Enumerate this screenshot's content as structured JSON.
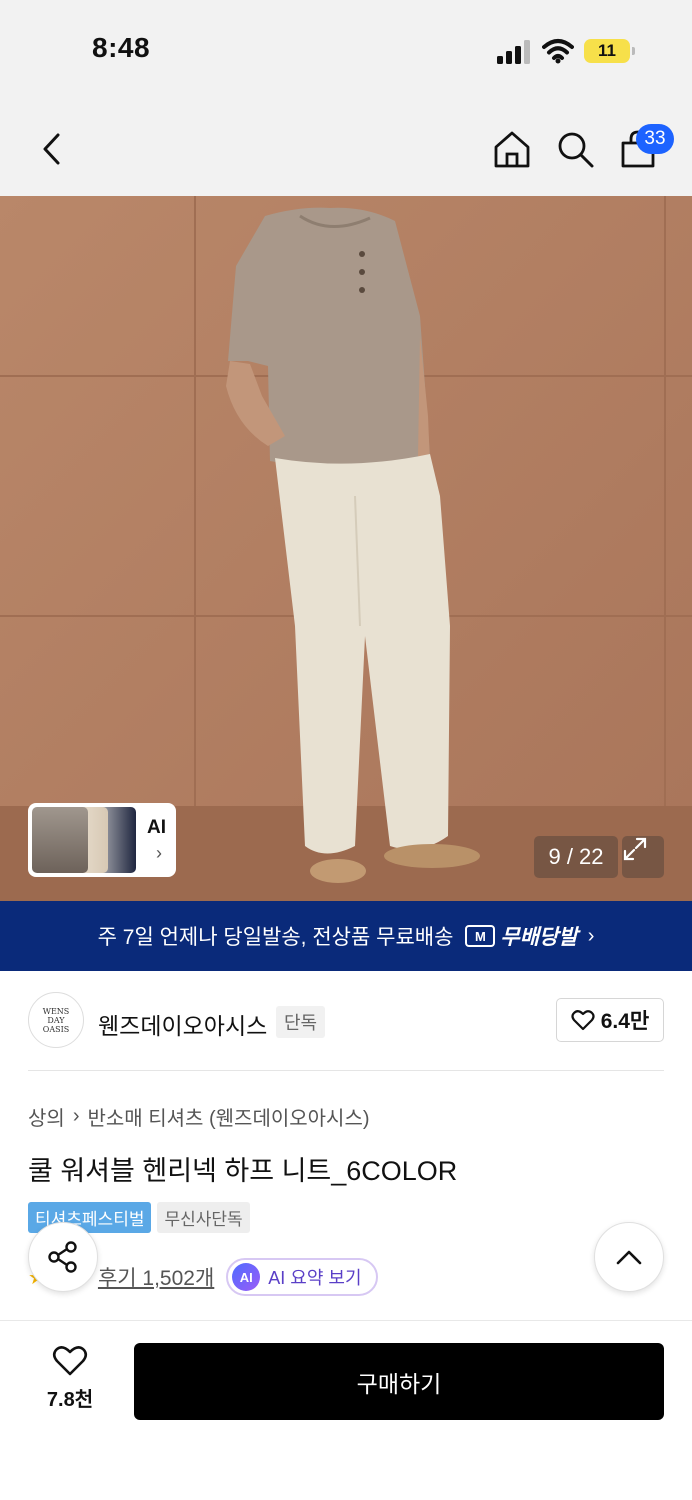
{
  "status_bar": {
    "time": "8:48",
    "battery": "11",
    "battery_level_percent": 11
  },
  "nav": {
    "cart_count": "33",
    "icons": [
      "back-chevron-icon",
      "home-icon",
      "search-icon",
      "cart-bag-icon"
    ]
  },
  "gallery": {
    "ai_label": "AI",
    "counter": "9 / 22"
  },
  "promo": {
    "text": "주 7일 언제나 당일발송, 전상품 무료배송",
    "logo_text": "무배당발",
    "truck_letter": "M"
  },
  "brand": {
    "logo_text": "WENS DAY OASIS",
    "name": "웬즈데이오아시스",
    "tag": "단독",
    "likes": "6.4만"
  },
  "product": {
    "breadcrumb": [
      "상의",
      "반소매 티셔츠 (웬즈데이오아시스)"
    ],
    "title": "쿨 워셔블 헨리넥 하프 니트_6COLOR",
    "tags": [
      "티셔츠페스티벌",
      "무신사단독"
    ],
    "reviews": "후기 1,502개",
    "ai_badge": "AI",
    "ai_summary": "AI 요약 보기"
  },
  "bottom": {
    "wish_count": "7.8천",
    "buy_label": "구매하기"
  },
  "colors": {
    "cart_badge": "#1d63ff",
    "promo_bg": "#0a2a7a",
    "buy_bg": "#000000",
    "tag_blue": "#5aa8e6"
  }
}
